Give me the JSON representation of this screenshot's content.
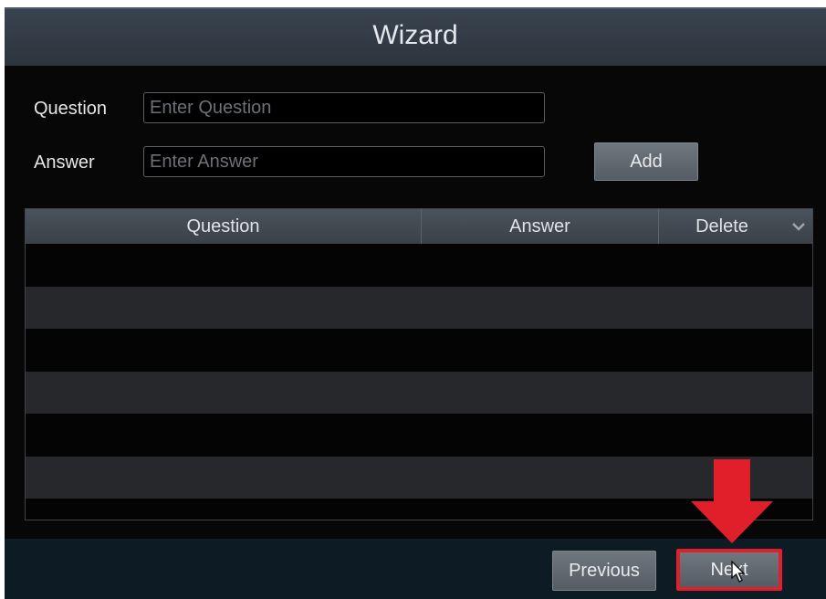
{
  "window": {
    "title": "Wizard"
  },
  "form": {
    "question_label": "Question",
    "question_placeholder": "Enter Question",
    "answer_label": "Answer",
    "answer_placeholder": "Enter Answer",
    "add_label": "Add"
  },
  "table": {
    "headers": {
      "question": "Question",
      "answer": "Answer",
      "delete": "Delete"
    },
    "rows": []
  },
  "footer": {
    "previous_label": "Previous",
    "next_label": "Next"
  },
  "annotation": {
    "arrow_color": "#e01f2a",
    "highlight_color": "#e01f2a"
  },
  "icons": {
    "dropdown": "chevron-down-icon",
    "pointer": "cursor-icon",
    "arrow": "arrow-down-icon"
  }
}
